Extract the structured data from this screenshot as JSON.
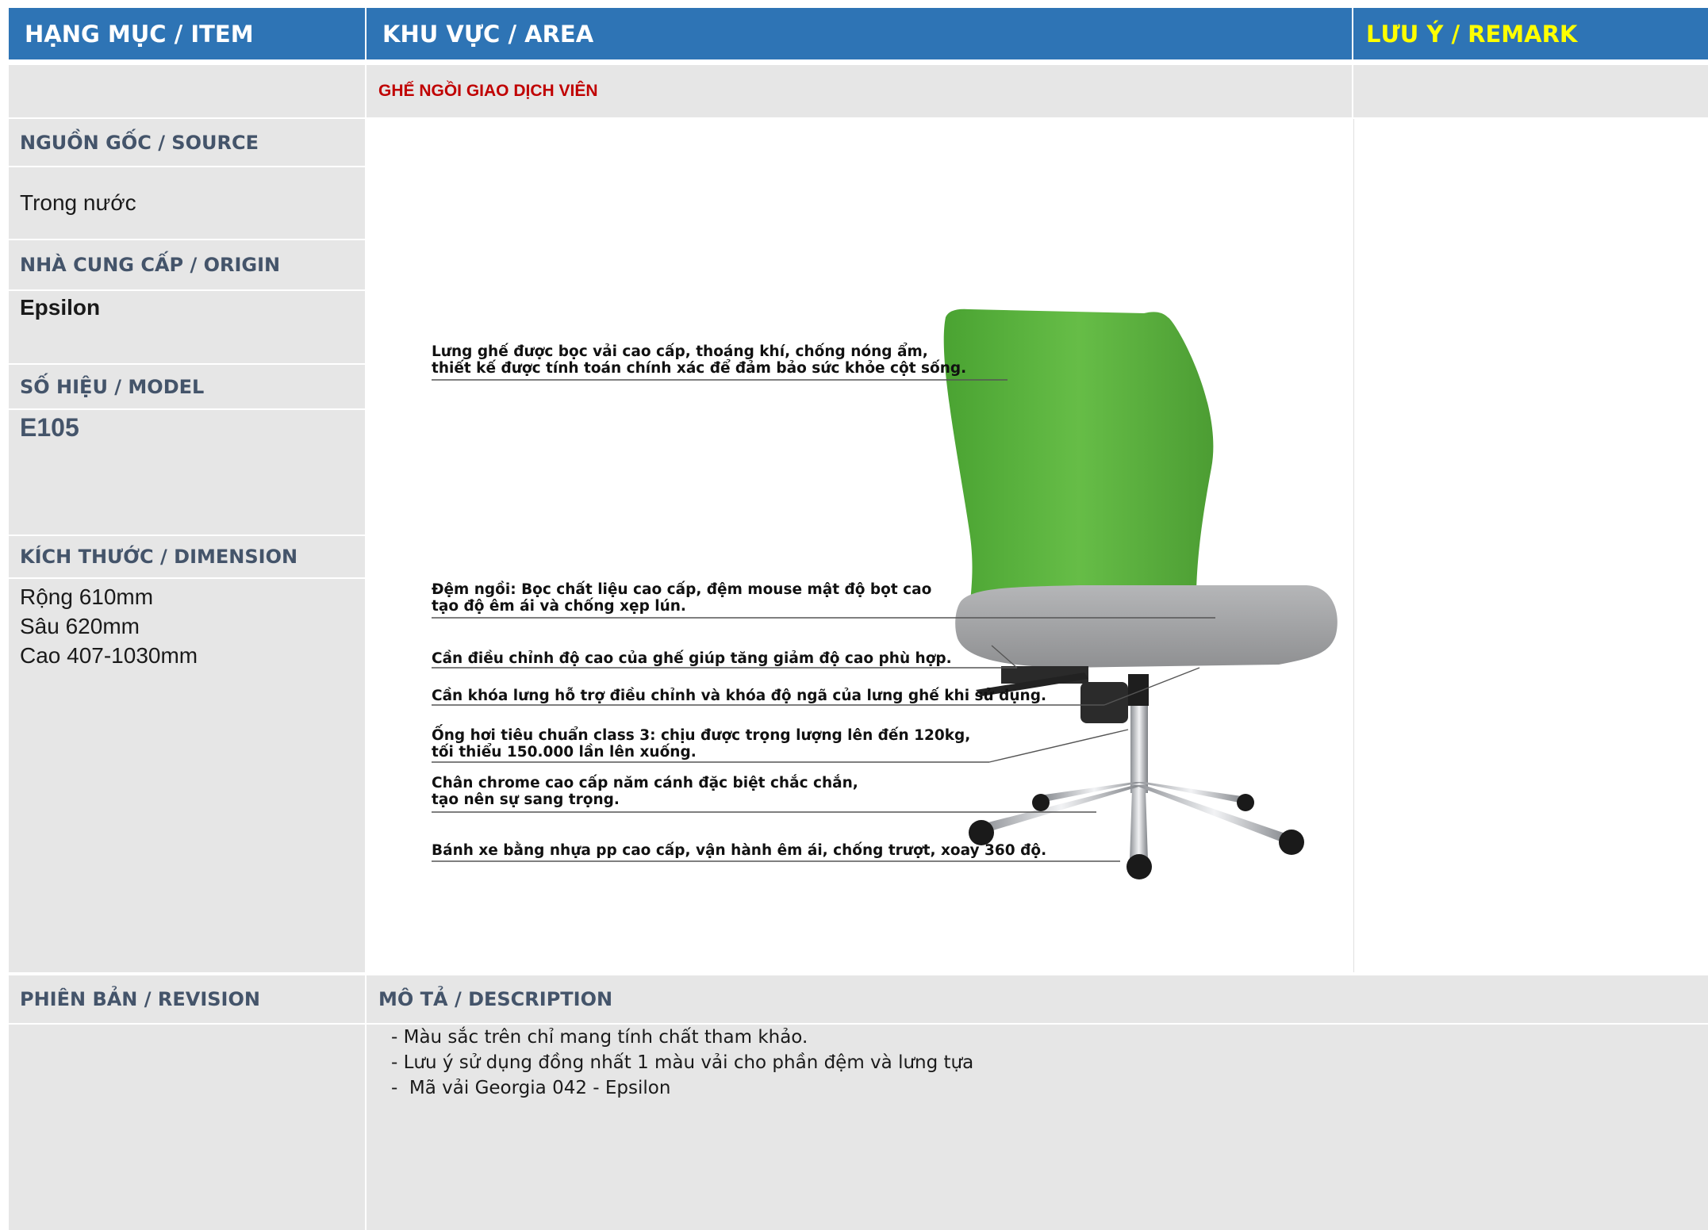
{
  "header": {
    "item": "HẠNG MỤC / ITEM",
    "area": "KHU VỰC / AREA",
    "remark": "LƯU Ý / REMARK"
  },
  "area_value": "GHẾ NGỒI GIAO DỊCH VIÊN",
  "source": {
    "label": "NGUỒN GỐC / SOURCE",
    "value": "Trong nước"
  },
  "origin": {
    "label": "NHÀ CUNG CẤP / ORIGIN",
    "value": "Epsilon"
  },
  "model": {
    "label": "SỐ HIỆU / MODEL",
    "value": "E105"
  },
  "dimension": {
    "label": "KÍCH THƯỚC / DIMENSION",
    "lines": [
      "Rộng 610mm",
      "Sâu 620mm",
      "Cao 407-1030mm"
    ]
  },
  "revision": {
    "label": "PHIÊN BẢN / REVISION",
    "value": ""
  },
  "description": {
    "label": "MÔ TẢ / DESCRIPTION",
    "lines": [
      "- Màu sắc trên chỉ mang tính chất tham khảo.",
      "- Lưu ý sử dụng đồng nhất 1 màu vải cho phần đệm và lưng tựa",
      "-  Mã vải Georgia 042 - Epsilon"
    ]
  },
  "annotations": [
    {
      "line1": "Lưng ghế được bọc vải cao cấp, thoáng khí, chống nóng ẩm,",
      "line2": "thiết kế được tính toán chính xác để đảm bảo sức khỏe cột sống."
    },
    {
      "line1": "Đệm ngồi: Bọc chất liệu cao cấp, đệm mouse mật độ bọt cao",
      "line2": "tạo độ êm ái và chống xẹp lún."
    },
    {
      "line1": "Cần điều chỉnh độ cao của ghế giúp tăng giảm độ cao phù hợp.",
      "line2": ""
    },
    {
      "line1": "Cần khóa lưng hỗ trợ điều chỉnh và khóa độ ngã của lưng ghế khi sử dụng.",
      "line2": ""
    },
    {
      "line1": "Ống hơi tiêu chuẩn class 3: chịu được trọng lượng lên đến 120kg,",
      "line2": "tối thiểu 150.000 lần lên xuống."
    },
    {
      "line1": "Chân chrome cao cấp năm cánh đặc biệt chắc chắn,",
      "line2": "tạo nên sự sang trọng."
    },
    {
      "line1": "Bánh xe bằng nhựa pp cao cấp, vận hành êm ái, chống trượt, xoay 360 độ.",
      "line2": ""
    }
  ],
  "colors": {
    "header_bg": "#2e74b5",
    "header_text": "#ffffff",
    "remark_text": "#ffff00",
    "label_text": "#44546a",
    "accent_red": "#c00000",
    "chair_back": "#5ab33f",
    "chair_seat": "#a9aaac"
  },
  "image": {
    "name": "office-chair-image"
  }
}
